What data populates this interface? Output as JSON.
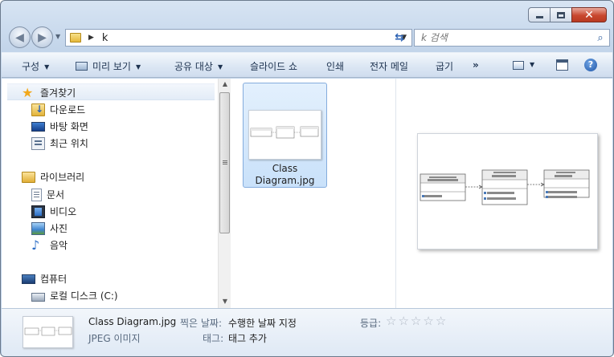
{
  "window": {
    "minimize_label": "minimize",
    "maximize_label": "maximize",
    "close_label": "close"
  },
  "address_bar": {
    "path_segment": "k",
    "search_placeholder": "k 검색"
  },
  "toolbar": {
    "organize": "구성",
    "preview": "미리 보기",
    "share": "공유 대상",
    "slideshow": "슬라이드 쇼",
    "print": "인쇄",
    "email": "전자 메일",
    "burn": "굽기",
    "more": "»",
    "help": "?"
  },
  "sidebar": {
    "favorites": {
      "label": "즐겨찾기",
      "items": [
        {
          "label": "다운로드",
          "icon": "downloads-folder-icon"
        },
        {
          "label": "바탕 화면",
          "icon": "desktop-icon"
        },
        {
          "label": "최근 위치",
          "icon": "recent-places-icon"
        }
      ]
    },
    "libraries": {
      "label": "라이브러리",
      "items": [
        {
          "label": "문서",
          "icon": "documents-icon"
        },
        {
          "label": "비디오",
          "icon": "videos-icon"
        },
        {
          "label": "사진",
          "icon": "pictures-icon"
        },
        {
          "label": "음악",
          "icon": "music-icon"
        }
      ]
    },
    "computer": {
      "label": "컴퓨터",
      "items": [
        {
          "label": "로컬 디스크 (C:)",
          "icon": "local-disk-icon"
        }
      ]
    }
  },
  "files": [
    {
      "name_line1": "Class",
      "name_line2": "Diagram.jpg",
      "selected": true
    }
  ],
  "details": {
    "filename": "Class Diagram.jpg",
    "filetype": "JPEG 이미지",
    "date_taken_label": "찍은 날짜:",
    "date_taken_value": "수행한 날짜 지정",
    "tags_label": "태그:",
    "tags_value": "태그 추가",
    "rating_label": "등급:",
    "rating_value": 0,
    "rating_max": 5
  },
  "colors": {
    "selection": "#cce4fb",
    "accent": "#2d63b4",
    "chrome": "#c3d5ea"
  }
}
